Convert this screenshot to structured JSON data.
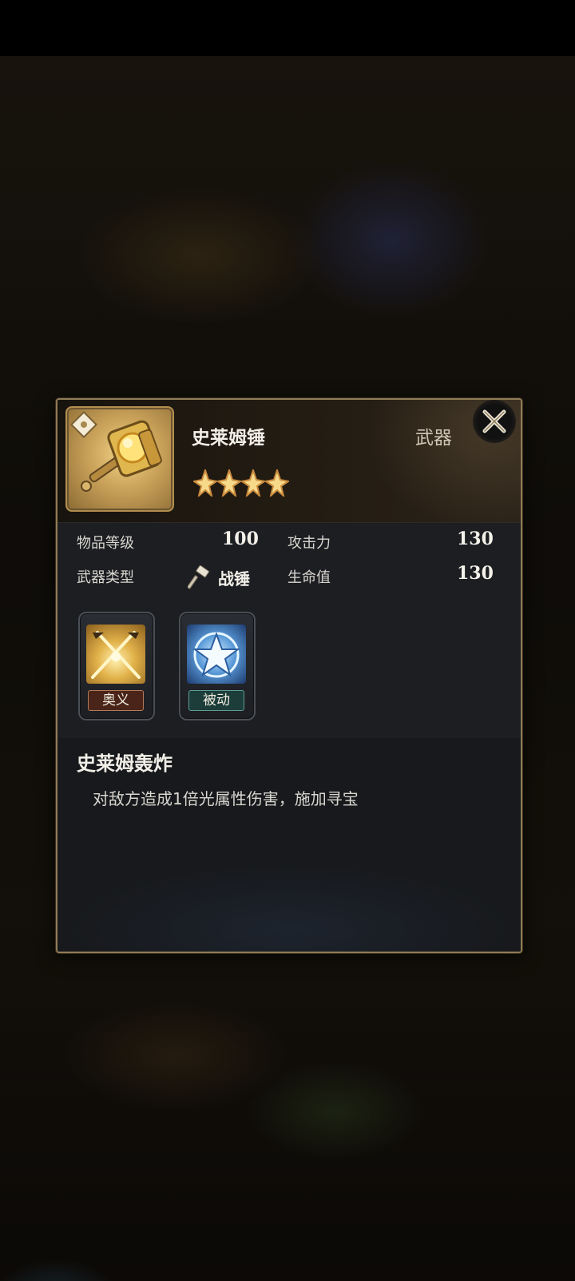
{
  "item": {
    "name": "史莱姆锤",
    "type_label": "武器",
    "star_count": 4,
    "icon": "golden-hammer-icon"
  },
  "stats": {
    "item_level_label": "物品等级",
    "item_level_value": "100",
    "attack_label": "攻击力",
    "attack_value": "130",
    "weapon_type_label": "武器类型",
    "weapon_type_value": "战锤",
    "hp_label": "生命值",
    "hp_value": "130"
  },
  "skills": [
    {
      "tag": "奥义",
      "icon": "crossed-swords-icon"
    },
    {
      "tag": "被动",
      "icon": "star-emblem-icon"
    }
  ],
  "skill_detail": {
    "title": "史莱姆轰炸",
    "description": "对敌方造成1倍光属性伤害，施加寻宝"
  },
  "colors": {
    "panel_border": "#8f7b55",
    "gold": "#e8b85a",
    "ult_tag": "#5a2a1c",
    "passive_tag": "#1f4a44"
  }
}
